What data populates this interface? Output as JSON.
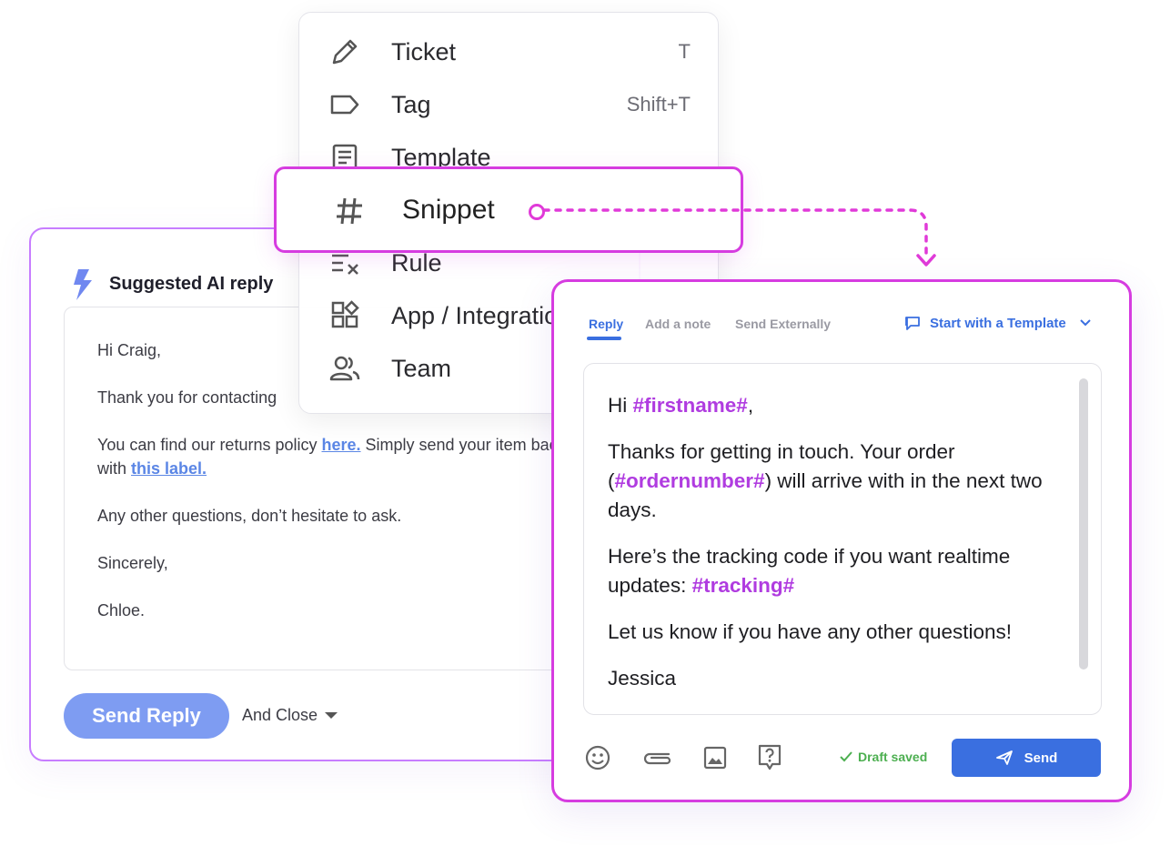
{
  "ai_card": {
    "title": "Suggested AI reply",
    "greeting": "Hi Craig,",
    "line1": "Thank you for contacting",
    "policy_prefix": "You can find our returns policy ",
    "policy_link": "here.",
    "policy_mid": " Simply send your item back with ",
    "label_link": "this label.",
    "line3": "Any other questions, don’t hesitate to ask.",
    "signoff": "Sincerely,",
    "signature": "Chloe.",
    "send_label": "Send Reply",
    "close_label": "And Close",
    "accent_color": "#7e9cf2"
  },
  "menu": {
    "items": [
      {
        "label": "Ticket",
        "shortcut": "T",
        "icon": "pencil-icon"
      },
      {
        "label": "Tag",
        "shortcut": "Shift+T",
        "icon": "tag-icon"
      },
      {
        "label": "Template",
        "shortcut": "",
        "icon": "document-icon"
      },
      {
        "label": "Snippet",
        "shortcut": "",
        "icon": "hash-icon"
      },
      {
        "label": "Rule",
        "shortcut": "",
        "icon": "rule-icon"
      },
      {
        "label": "App / Integration",
        "shortcut": "",
        "icon": "apps-icon"
      },
      {
        "label": "Team",
        "shortcut": "",
        "icon": "team-icon"
      }
    ],
    "highlight_color": "#d63ce0"
  },
  "composer": {
    "tabs": [
      "Reply",
      "Add a note",
      "Send Externally"
    ],
    "template_label": "Start with a Template",
    "greeting_prefix": "Hi ",
    "var_firstname": "#firstname#",
    "greeting_suffix": ",",
    "order_text_1": "Thanks for getting in touch. Your order (",
    "var_ordernumber": "#ordernumber#",
    "order_text_2": ") will arrive with in the next two days.",
    "tracking_text": "Here’s the tracking code if you want realtime updates: ",
    "var_tracking": "#tracking#",
    "questions_text": "Let us know if you have any other questions!",
    "signature": "Jessica",
    "draft_status": "Draft saved",
    "send_label": "Send",
    "primary_color": "#3a6fe0",
    "variable_color": "#b03ce0"
  }
}
